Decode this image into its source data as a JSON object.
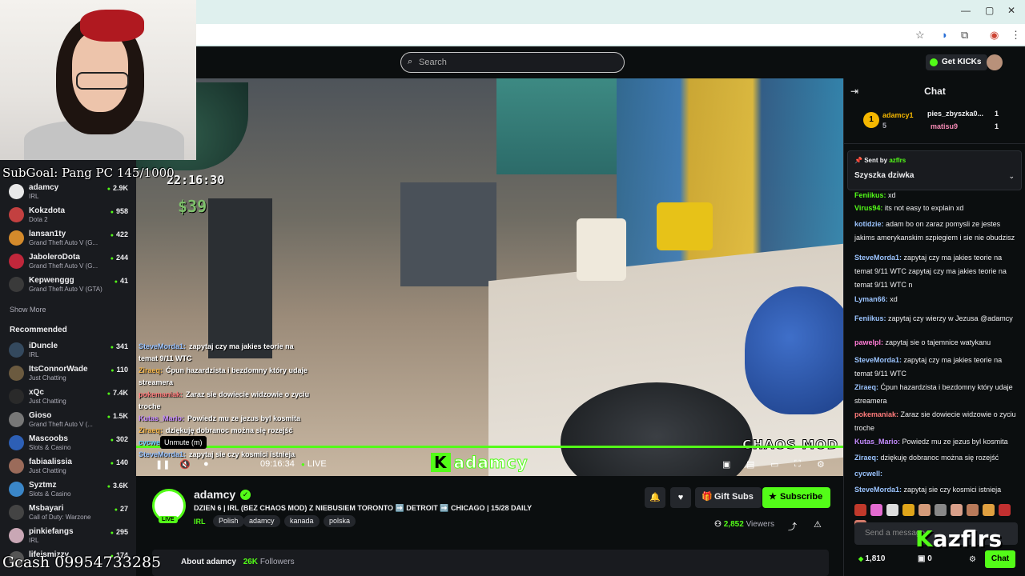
{
  "search": {
    "placeholder": "Search"
  },
  "header": {
    "get_kicks": "Get KICKs"
  },
  "sidebar": {
    "following": [
      {
        "name": "adamcy",
        "category": "IRL",
        "viewers": "2.9K",
        "color": "#e8e8e8"
      },
      {
        "name": "Kokzdota",
        "category": "Dota 2",
        "viewers": "958",
        "color": "#c34040"
      },
      {
        "name": "lansan1ty",
        "category": "Grand Theft Auto V (G...",
        "viewers": "422",
        "color": "#d48a2b"
      },
      {
        "name": "JaboleroDota",
        "category": "Grand Theft Auto V (G...",
        "viewers": "244",
        "color": "#c0273b"
      },
      {
        "name": "Kepwenggg",
        "category": "Grand Theft Auto V (GTA)",
        "viewers": "41",
        "color": "#3a3a3a"
      }
    ],
    "show_more": "Show More",
    "recommended_title": "Recommended",
    "recommended": [
      {
        "name": "iDuncle",
        "category": "IRL",
        "viewers": "341",
        "color": "#34495e"
      },
      {
        "name": "ItsConnorWade",
        "category": "Just Chatting",
        "viewers": "110",
        "color": "#6b5a3f"
      },
      {
        "name": "xQc",
        "category": "Just Chatting",
        "viewers": "7.4K",
        "color": "#2a2a2a"
      },
      {
        "name": "Gioso",
        "category": "Grand Theft Auto V (...",
        "viewers": "1.5K",
        "color": "#777"
      },
      {
        "name": "Mascoobs",
        "category": "Slots & Casino",
        "viewers": "302",
        "color": "#2d5fb5"
      },
      {
        "name": "fabiaalissia",
        "category": "Just Chatting",
        "viewers": "140",
        "color": "#9b6b5a"
      },
      {
        "name": "Syztmz",
        "category": "Slots & Casino",
        "viewers": "3.6K",
        "color": "#3a86c8"
      },
      {
        "name": "Msbayari",
        "category": "Call of Duty: Warzone",
        "viewers": "27",
        "color": "#444"
      },
      {
        "name": "pinkiefangs",
        "category": "IRL",
        "viewers": "295",
        "color": "#c9a7b5"
      },
      {
        "name": "lifeismizzy",
        "category": "",
        "viewers": "174",
        "color": "#555"
      }
    ]
  },
  "overlay": {
    "subgoal": "SubGoal: Pang PC 145/1000",
    "gcash": "Gcash 09954733285",
    "gta_time": "22:16:30",
    "gta_money": "$39",
    "chaos_mod": "CHAOS MOD",
    "brand_name": "adamcy",
    "brand_k": "K",
    "chat": [
      {
        "user": "SteveMorda1:",
        "text": "zapytaj czy ma jakies teorie na temat 9/11 WTC",
        "color": "#9bc4ff"
      },
      {
        "user": "Ziraeq:",
        "text": "Ćpun hazardzista i bezdomny który udaje streamera",
        "color": "#f7b84b"
      },
      {
        "user": "pokemaniak:",
        "text": "Zaraz sie dowiecie widzowie o zyciu troche",
        "color": "#ff7b7b"
      },
      {
        "user": "Kutas_Mario:",
        "text": "Powiedz mu ze jezus byl kosmita",
        "color": "#c58cff"
      },
      {
        "user": "Ziraeq:",
        "text": "dziękuję dobranoc można się rozejść",
        "color": "#f7b84b"
      },
      {
        "user": "cycwell:",
        "text": "",
        "color": "#6ad3ff"
      },
      {
        "user": "SteveMorda1:",
        "text": "zapytaj sie czy kosmici istnieja",
        "color": "#9bc4ff"
      }
    ]
  },
  "player": {
    "tooltip": "Unmute (m)",
    "time": "09:16:34",
    "live": "LIVE",
    "progress": 1.0
  },
  "channel": {
    "name": "adamcy",
    "live_badge": "LIVE",
    "title": "DZIEN 6 | IRL (BEZ CHAOS MOD) Z NIEBUSIEM TORONTO ➡️ DETROIT ➡️ CHICAGO | 15/28 DAILY",
    "category": "IRL",
    "tags": [
      "Polish",
      "adamcy",
      "kanada",
      "polska"
    ],
    "gift_subs": "Gift Subs",
    "subscribe": "Subscribe",
    "viewers": "2,852",
    "viewers_label": "Viewers",
    "about": "About adamcy",
    "followers": "26K",
    "followers_label": "Followers"
  },
  "chat": {
    "title": "Chat",
    "gifters": [
      {
        "rank": "1",
        "name": "adamcy1",
        "count": "5"
      },
      {
        "name": "pies_zbyszka0...",
        "count": "1"
      },
      {
        "name": "matisu9",
        "count": "1"
      }
    ],
    "pinned": {
      "sent_by_label": "Sent by",
      "sender": "azflrs",
      "message": "Szyszka dziwka"
    },
    "messages": [
      {
        "user": "Feniikus:",
        "text": "xd",
        "color": "#53fc18"
      },
      {
        "user": "Virus94:",
        "text": "its not easy to explain xd",
        "color": "#53fc18"
      },
      {
        "user": "kotidzie:",
        "text": "adam bo on zaraz pomysli ze jestes jakims amerykanskim szpiegiem i sie nie obudzisz",
        "color": "#9bc4ff"
      },
      {
        "user": "SteveMorda1:",
        "text": "zapytaj czy ma jakies teorie na temat 9/11 WTC zapytaj czy ma jakies teorie na temat 9/11 WTC n",
        "color": "#9bc4ff"
      },
      {
        "user": "Lyman66:",
        "text": "xd",
        "color": "#9bc4ff"
      },
      {
        "user": "Feniikus:",
        "text": "zapytaj czy wierzy w Jezusa @adamcy",
        "color": "#9bc4ff"
      },
      {
        "user": "pawelpl:",
        "text": "zapytaj sie o tajemnice watykanu",
        "color": "#ff7bd5"
      },
      {
        "user": "SteveMorda1:",
        "text": "zapytaj czy ma jakies teorie na temat 9/11 WTC",
        "color": "#9bc4ff"
      },
      {
        "user": "Ziraeq:",
        "text": "Ćpun hazardzista i bezdomny który udaje streamera",
        "color": "#9bc4ff"
      },
      {
        "user": "pokemaniak:",
        "text": "Zaraz sie dowiecie widzowie o zyciu troche",
        "color": "#ff7b7b"
      },
      {
        "user": "Kutas_Mario:",
        "text": "Powiedz mu ze jezus byl kosmita",
        "color": "#c58cff"
      },
      {
        "user": "Ziraeq:",
        "text": "dziękuję dobranoc można się rozejść",
        "color": "#9bc4ff"
      },
      {
        "user": "cycwell:",
        "text": "",
        "color": "#9bc4ff"
      },
      {
        "user": "SteveMorda1:",
        "text": "zapytaj sie czy kosmici istnieja",
        "color": "#9bc4ff"
      }
    ],
    "send_placeholder": "Send a message",
    "points": "1,810",
    "gift_count": "0",
    "chat_button": "Chat",
    "watermark": "azflrs",
    "watermark_k": "K"
  },
  "colors": {
    "accent": "#53fc18",
    "bg": "#0b0e0f",
    "panel": "#191b1f"
  }
}
